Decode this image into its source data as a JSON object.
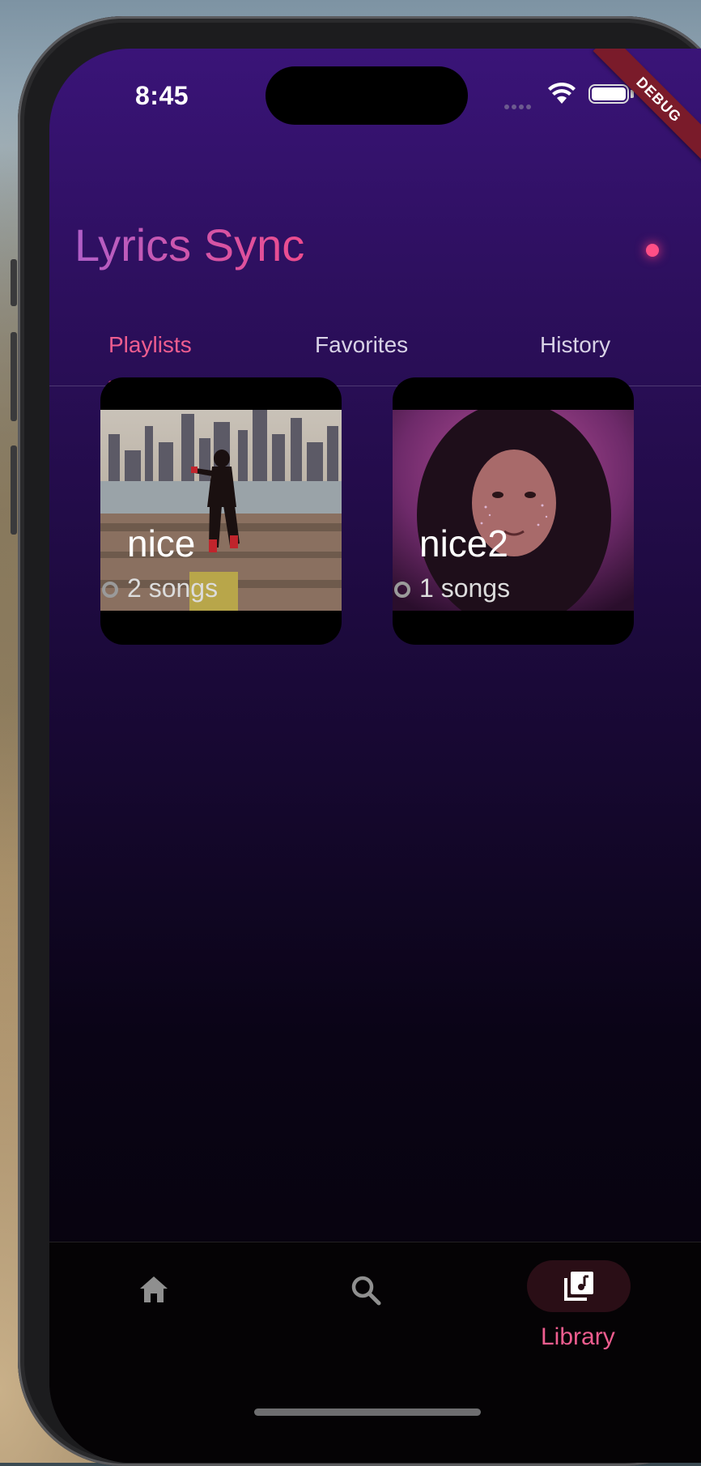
{
  "status_bar": {
    "time": "8:45",
    "debug_banner": "DEBUG"
  },
  "app": {
    "title": "Lyrics Sync",
    "accent_color": "#ee4c8d"
  },
  "tabs": [
    {
      "label": "Playlists",
      "active": true
    },
    {
      "label": "Favorites",
      "active": false
    },
    {
      "label": "History",
      "active": false
    }
  ],
  "playlists": [
    {
      "name": "nice",
      "count_label": "2 songs",
      "cover": "city-skyline-hero"
    },
    {
      "name": "nice2",
      "count_label": "1 songs",
      "cover": "portrait-purple"
    }
  ],
  "bottom_nav": {
    "items": [
      {
        "icon": "home-icon",
        "label": "",
        "active": false
      },
      {
        "icon": "search-icon",
        "label": "",
        "active": false
      },
      {
        "icon": "library-music-icon",
        "label": "Library",
        "active": true
      }
    ]
  }
}
